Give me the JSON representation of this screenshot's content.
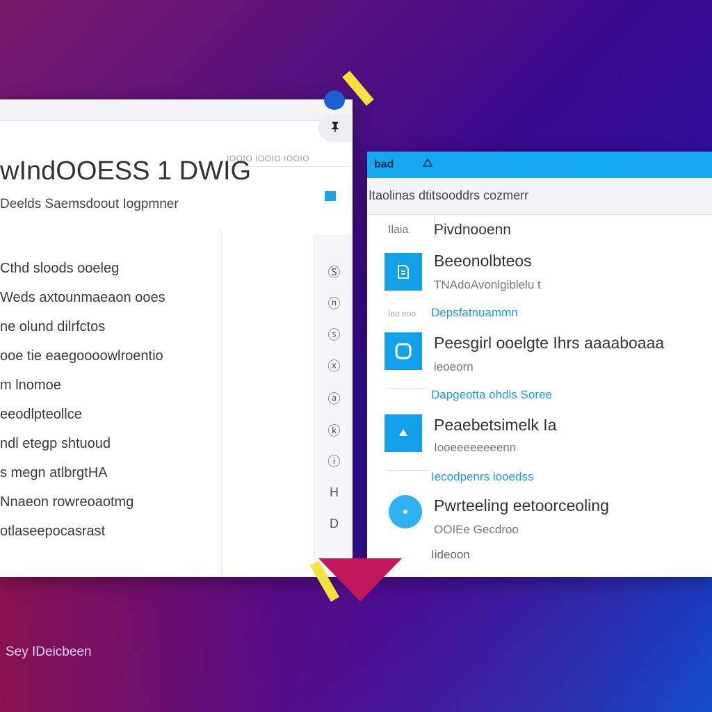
{
  "left_window": {
    "breadcrumb": "IOOIO IOOIO IOOIO",
    "title": "wIndOOESS 1 DWIG",
    "subtitle": "Deelds Saemsdoout Iogpmner",
    "items": [
      "Cthd sloods ooeleg",
      "Weds axtounmaeaon ooes",
      "ne olund dilrfctos",
      "ooe tie eaegoooowlroentio",
      "m lnomoe",
      "eeodlpteollce",
      "ndl etegp shtuoud",
      "s megn atlbrgtHA",
      "Nnaeon rowreoaotmg",
      "otlaseepocasrast"
    ],
    "rail_icons": [
      "Ⓢ",
      "ⓝ",
      "ⓢ",
      "ⓧ",
      "ⓐ",
      "ⓚ",
      "ⓘ",
      "H",
      "D"
    ]
  },
  "right_window": {
    "app_label": "bad",
    "toolbar_text": "Itaolinas dtitsooddrs cozmerr",
    "header_label": "Ilaia",
    "header_text": "Pivdnooenn",
    "items": [
      {
        "title": "Beeonolbteos",
        "subtitle": "TNAdoAvonlgiblelu t",
        "link_label": "Ioo ooo",
        "link": "Depsfatnuammn"
      },
      {
        "title": "Peesgirl ooelgte Ihrs aaaaboaaa",
        "subtitle": "ieoeorn",
        "link": "Dapgeotta ohdis Soree"
      },
      {
        "title": "Peaebetsimelk Ia",
        "subtitle": "Iooeeeeeeeenn",
        "link": "Iecodpenrs iooedss"
      },
      {
        "title": "Pwrteeling eetoorceoling",
        "subtitle": "OOIEe Gecdroo",
        "link": "Iideoon"
      }
    ]
  },
  "footer": {
    "label": "Sey IDeicbeen"
  },
  "colors": {
    "accent": "#13a8f0",
    "tile": "#13a0ea",
    "link": "#1c9ad8",
    "decor_yellow": "#f4e33a",
    "decor_red": "#c2185b"
  }
}
